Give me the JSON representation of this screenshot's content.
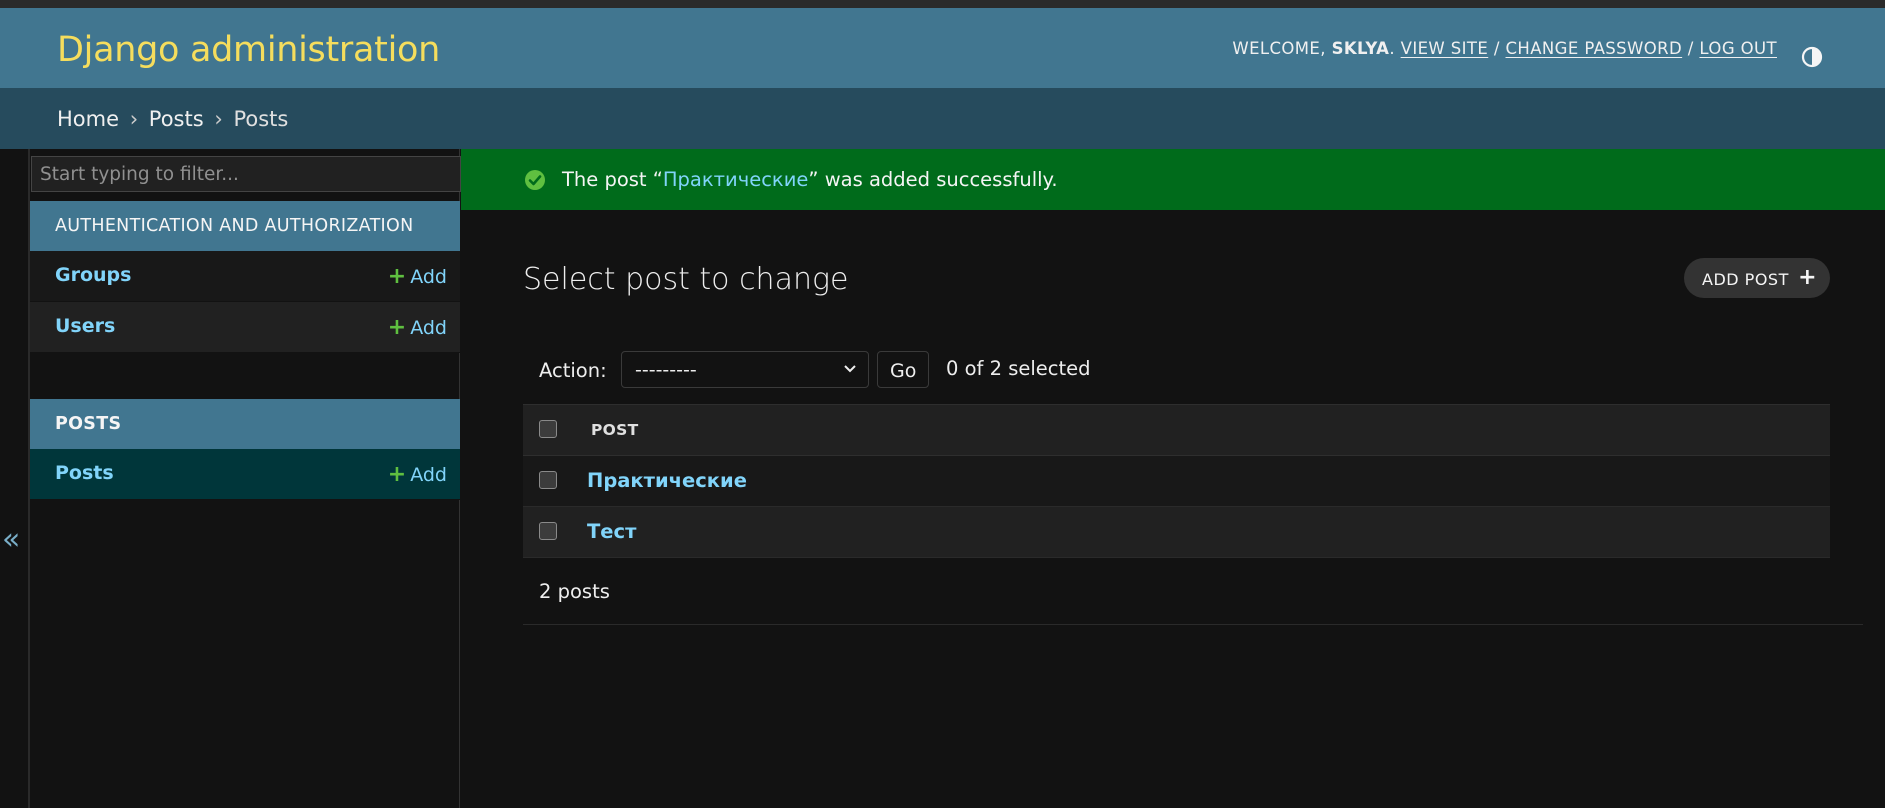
{
  "header": {
    "brand": "Django administration",
    "welcome": "Welcome,",
    "username": "SKLYA",
    "view_site": "View site",
    "change_password": "Change password",
    "log_out": "Log out",
    "separator": "/"
  },
  "breadcrumbs": {
    "home": "Home",
    "app": "Posts",
    "current": "Posts",
    "sep": "›"
  },
  "sidebar": {
    "filter_placeholder": "Start typing to filter...",
    "toggle": "«",
    "modules": [
      {
        "caption": "Authentication and Authorization",
        "rows": [
          {
            "label": "Groups",
            "add": "Add"
          },
          {
            "label": "Users",
            "add": "Add"
          }
        ]
      },
      {
        "caption": "Posts",
        "rows": [
          {
            "label": "Posts",
            "add": "Add"
          }
        ]
      }
    ]
  },
  "message": {
    "prefix": "The post “",
    "link": "Практические",
    "suffix": "” was added successfully."
  },
  "content": {
    "title": "Select post to change",
    "add_button": "Add post",
    "action_label": "Action:",
    "action_selected": "---------",
    "go": "Go",
    "counter": "0 of 2 selected",
    "column": "Post",
    "rows": [
      "Практические",
      "Тест"
    ],
    "paginator": "2 posts"
  },
  "colors": {
    "header_bg": "#417690",
    "brand": "#f5dd5d",
    "breadcrumbs_bg": "#264b5d",
    "success_bg": "#006b1b",
    "link": "#81d4fa",
    "add_plus": "#5fbf40"
  }
}
